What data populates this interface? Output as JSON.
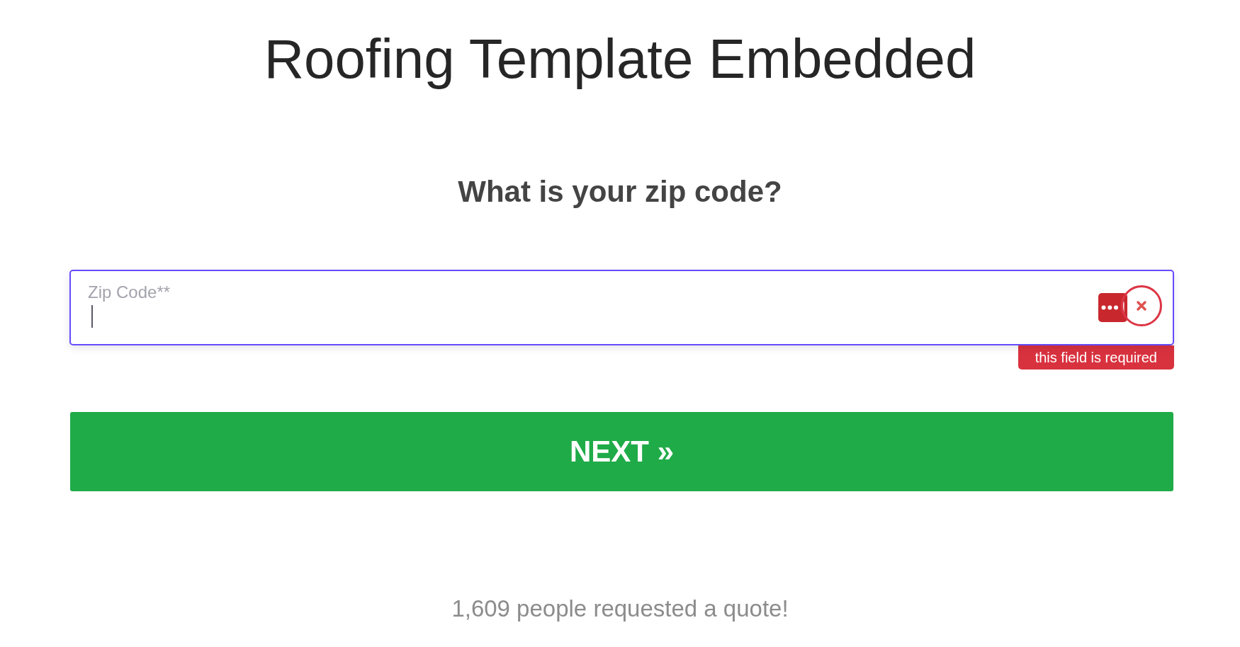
{
  "title": "Roofing Template Embedded",
  "question": "What is your zip code?",
  "zip_field": {
    "label": "Zip Code**",
    "focused": true,
    "invalid": true,
    "error_message": "this field is required"
  },
  "next_button": {
    "label": "NEXT »"
  },
  "footer": "1,609 people requested a quote!"
}
